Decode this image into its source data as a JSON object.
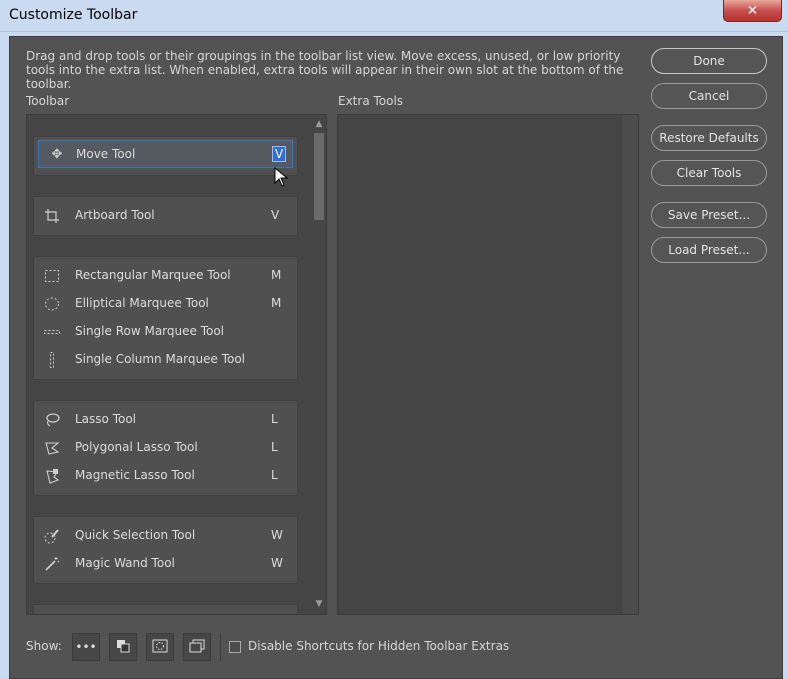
{
  "window": {
    "title": "Customize Toolbar",
    "close_glyph": "✕"
  },
  "description": "Drag and drop tools or their groupings in the toolbar list view. Move excess, unused, or low priority tools into the extra list. When enabled, extra tools will appear in their own slot at the bottom of the toolbar.",
  "labels": {
    "toolbar": "Toolbar",
    "extra_tools": "Extra Tools"
  },
  "groups": [
    {
      "tools": [
        {
          "name": "Move Tool",
          "key": "V",
          "icon": "move-icon"
        }
      ]
    },
    {
      "tools": [
        {
          "name": "Artboard Tool",
          "key": "V",
          "icon": "artboard-icon"
        }
      ]
    },
    {
      "tools": [
        {
          "name": "Rectangular Marquee Tool",
          "key": "M",
          "icon": "rect-marquee-icon"
        },
        {
          "name": "Elliptical Marquee Tool",
          "key": "M",
          "icon": "ellipse-marquee-icon"
        },
        {
          "name": "Single Row Marquee Tool",
          "key": "",
          "icon": "row-marquee-icon"
        },
        {
          "name": "Single Column Marquee Tool",
          "key": "",
          "icon": "column-marquee-icon"
        }
      ]
    },
    {
      "tools": [
        {
          "name": "Lasso Tool",
          "key": "L",
          "icon": "lasso-icon"
        },
        {
          "name": "Polygonal Lasso Tool",
          "key": "L",
          "icon": "polygonal-lasso-icon"
        },
        {
          "name": "Magnetic Lasso Tool",
          "key": "L",
          "icon": "magnetic-lasso-icon"
        }
      ]
    },
    {
      "tools": [
        {
          "name": "Quick Selection Tool",
          "key": "W",
          "icon": "quick-selection-icon"
        },
        {
          "name": "Magic Wand Tool",
          "key": "W",
          "icon": "magic-wand-icon"
        }
      ]
    }
  ],
  "buttons": {
    "done": "Done",
    "cancel": "Cancel",
    "restore_defaults": "Restore Defaults",
    "clear_tools": "Clear Tools",
    "save_preset": "Save Preset...",
    "load_preset": "Load Preset..."
  },
  "footer": {
    "show_label": "Show:",
    "show_buttons": [
      "more-icon",
      "fg-bg-color-icon",
      "quick-mask-icon",
      "screen-mode-icon"
    ],
    "checkbox_label": "Disable Shortcuts for Hidden Toolbar Extras",
    "checkbox_checked": false
  },
  "colors": {
    "panel_bg": "#535353",
    "list_bg": "#454545",
    "selection_blue": "#2f6fd6"
  }
}
